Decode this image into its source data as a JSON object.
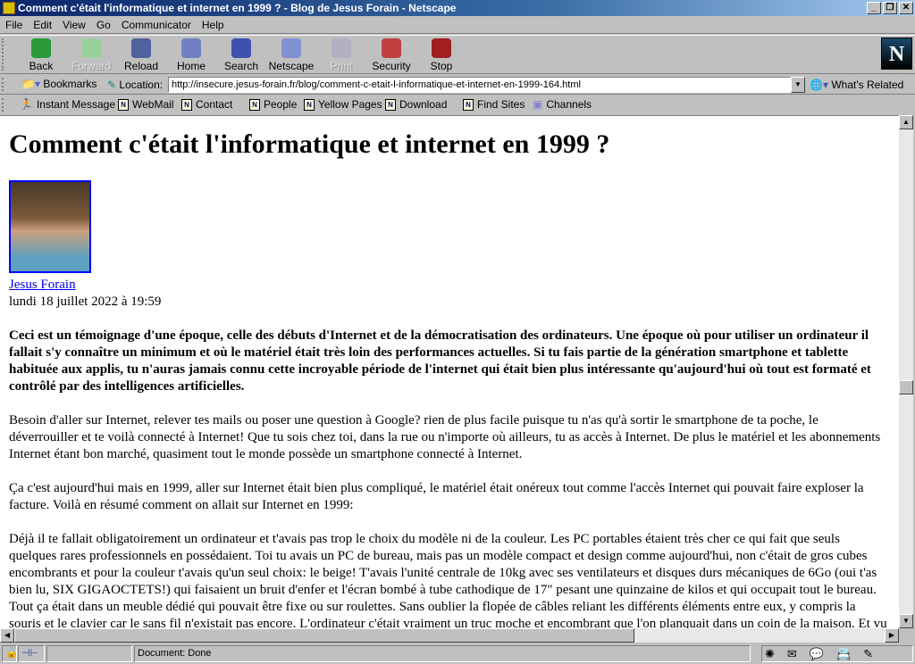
{
  "window": {
    "title": "Comment c'était l'informatique et internet en 1999 ? - Blog de Jesus Forain - Netscape"
  },
  "menu": [
    "File",
    "Edit",
    "View",
    "Go",
    "Communicator",
    "Help"
  ],
  "toolbar": [
    {
      "label": "Back",
      "icon": "back-arrow-icon",
      "enabled": true,
      "color": "#2a9a3a"
    },
    {
      "label": "Forward",
      "icon": "forward-arrow-icon",
      "enabled": false,
      "color": "#9ad09a"
    },
    {
      "label": "Reload",
      "icon": "reload-icon",
      "enabled": true,
      "color": "#5060a0"
    },
    {
      "label": "Home",
      "icon": "home-icon",
      "enabled": true,
      "color": "#7080c0"
    },
    {
      "label": "Search",
      "icon": "search-icon",
      "enabled": true,
      "color": "#4050b0"
    },
    {
      "label": "Netscape",
      "icon": "my-netscape-icon",
      "enabled": true,
      "color": "#8090d0"
    },
    {
      "label": "Print",
      "icon": "print-icon",
      "enabled": false,
      "color": "#b0b0c0"
    },
    {
      "label": "Security",
      "icon": "padlock-icon",
      "enabled": true,
      "color": "#c04040"
    },
    {
      "label": "Stop",
      "icon": "stop-icon",
      "enabled": true,
      "color": "#a02020"
    }
  ],
  "location": {
    "bookmarks": "Bookmarks",
    "label": "Location:",
    "url": "http://insecure.jesus-forain.fr/blog/comment-c-etait-l-informatique-et-internet-en-1999-164.html",
    "related": "What's Related"
  },
  "personal": [
    "Instant Message",
    "WebMail",
    "Contact",
    "People",
    "Yellow Pages",
    "Download",
    "Find Sites",
    "Channels"
  ],
  "article": {
    "title": "Comment c'était l'informatique et internet en 1999 ?",
    "author": "Jesus Forain",
    "date": "lundi 18 juillet 2022 à 19:59",
    "lead": "Ceci est un témoignage d'une époque, celle des débuts d'Internet et de la démocratisation des ordinateurs. Une époque où pour utiliser un ordinateur il fallait s'y connaître un minimum et où le matériel était très loin des performances actuelles. Si tu fais partie de la génération smartphone et tablette habituée aux applis, tu n'auras jamais connu cette incroyable période de l'internet qui était bien plus intéressante qu'aujourd'hui où tout est formaté et contrôlé par des intelligences artificielles.",
    "paragraphs": [
      "Besoin d'aller sur Internet, relever tes mails ou poser une question à Google? rien de plus facile puisque tu n'as qu'à sortir le smartphone de ta poche, le déverrouiller et te voilà connecté à Internet! Que tu sois chez toi, dans la rue ou n'importe où ailleurs, tu as accès à Internet. De plus le matériel et les abonnements Internet étant bon marché, quasiment tout le monde possède un smartphone connecté à Internet.",
      "Ça c'est aujourd'hui mais en 1999, aller sur Internet était bien plus compliqué, le matériel était onéreux tout comme l'accès Internet qui pouvait faire exploser la facture. Voilà en résumé comment on allait sur Internet en 1999:",
      "Déjà il te fallait obligatoirement un ordinateur et t'avais pas trop le choix du modèle ni de la couleur. Les PC portables étaient très cher ce qui fait que seuls quelques rares professionnels en possédaient. Toi tu avais un PC de bureau, mais pas un modèle compact et design comme aujourd'hui, non c'était de gros cubes encombrants et pour la couleur t'avais qu'un seul choix: le beige! T'avais l'unité centrale de 10kg avec ses ventilateurs et disques durs mécaniques de 6Go (oui t'as bien lu, SIX GIGAOCTETS!) qui faisaient un bruit d'enfer et l'écran bombé à tube cathodique de 17\" pesant une quinzaine de kilos et qui occupait tout le bureau. Tout ça était dans un meuble dédié qui pouvait être fixe ou sur roulettes. Sans oublier la flopée de câbles reliant les différents éléments entre eux, y compris la souris et le clavier car le sans fil n'existait pas encore. L'ordinateur c'était vraiment un truc moche et encombrant que l'on planquait dans un coin de la maison. Et vu le prix"
    ]
  },
  "status": {
    "text": "Document: Done"
  }
}
